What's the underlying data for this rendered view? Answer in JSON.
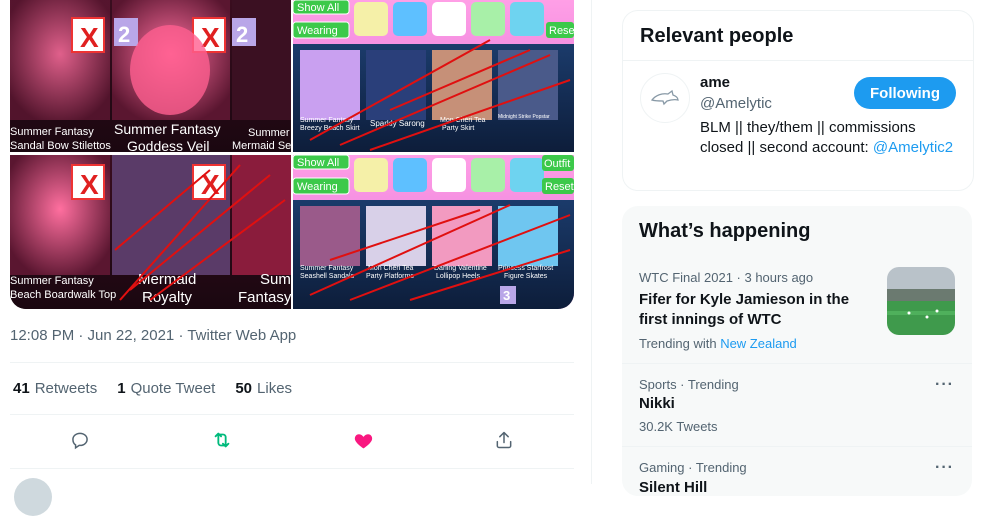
{
  "media": {
    "tile1": {
      "caption_left": "Summer Fantasy\nSandal Bow Stilettos",
      "caption_center": "Summer Fantasy\nGoddess Veil",
      "caption_right": "Summer\nMermaid Sea",
      "badge": "2"
    },
    "tile3": {
      "caption_left": "Summer Fantasy\nBeach Boardwalk Top",
      "caption_center": "Mermaid\nRoyalty",
      "caption_right": "Sum\nFantasy"
    },
    "tile2": {
      "show_all": "Show All",
      "wearing": "Wearing",
      "reset": "Rese",
      "items": [
        "Summer Fantasy\nBreezy Beach Skirt",
        "Sparkly Sarong",
        "Mon Chéri Tea\nParty Skirt",
        "Midnight Strike Popstar\nPerformance Skirt"
      ]
    },
    "tile4": {
      "show_all": "Show All",
      "wearing": "Wearing",
      "outfit": "Outfit",
      "reset": "Reset",
      "items": [
        "Summer Fantasy\nSeashell Sandals",
        "Mon Chéri Tea\nParty Platforms",
        "Darling Valentine\nLollipop Heels",
        "Princess Starfrost\nFigure Skates"
      ]
    }
  },
  "tweet": {
    "timestamp": "12:08 PM · Jun 22, 2021 · Twitter Web App",
    "stats": [
      {
        "count": "41",
        "label": "Retweets"
      },
      {
        "count": "1",
        "label": "Quote Tweet"
      },
      {
        "count": "50",
        "label": "Likes"
      }
    ],
    "actions": {
      "reply_icon": "reply-icon",
      "retweet_icon": "retweet-icon",
      "like_icon": "heart-icon",
      "share_icon": "share-icon"
    },
    "colors": {
      "retweet": "#00ba7c",
      "like": "#f91880"
    }
  },
  "relevant_people": {
    "title": "Relevant people",
    "person": {
      "name": "ame",
      "handle": "@Amelytic",
      "follow_label": "Following",
      "bio_text": "BLM || they/them || commissions closed || second account:",
      "bio_mention": "@Amelytic2"
    }
  },
  "whats_happening": {
    "title": "What’s happening",
    "trends": [
      {
        "meta": "WTC Final 2021 · 3 hours ago",
        "name": "Fifer for Kyle Jamieson in the first innings of WTC",
        "sub_prefix": "Trending with",
        "sub_link": "New Zealand"
      },
      {
        "meta": "Sports · Trending",
        "name": "Nikki",
        "sub": "30.2K Tweets"
      },
      {
        "meta": "Gaming · Trending",
        "name": "Silent Hill"
      }
    ]
  },
  "accent": "#1d9bf0"
}
